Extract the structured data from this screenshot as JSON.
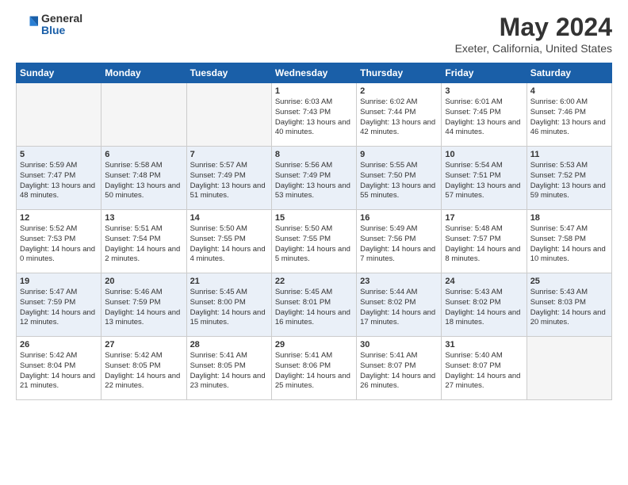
{
  "header": {
    "logo": {
      "general": "General",
      "blue": "Blue"
    },
    "title": "May 2024",
    "location": "Exeter, California, United States"
  },
  "weekdays": [
    "Sunday",
    "Monday",
    "Tuesday",
    "Wednesday",
    "Thursday",
    "Friday",
    "Saturday"
  ],
  "weeks": [
    [
      {
        "day": "",
        "sunrise": "",
        "sunset": "",
        "daylight": ""
      },
      {
        "day": "",
        "sunrise": "",
        "sunset": "",
        "daylight": ""
      },
      {
        "day": "",
        "sunrise": "",
        "sunset": "",
        "daylight": ""
      },
      {
        "day": "1",
        "sunrise": "Sunrise: 6:03 AM",
        "sunset": "Sunset: 7:43 PM",
        "daylight": "Daylight: 13 hours and 40 minutes."
      },
      {
        "day": "2",
        "sunrise": "Sunrise: 6:02 AM",
        "sunset": "Sunset: 7:44 PM",
        "daylight": "Daylight: 13 hours and 42 minutes."
      },
      {
        "day": "3",
        "sunrise": "Sunrise: 6:01 AM",
        "sunset": "Sunset: 7:45 PM",
        "daylight": "Daylight: 13 hours and 44 minutes."
      },
      {
        "day": "4",
        "sunrise": "Sunrise: 6:00 AM",
        "sunset": "Sunset: 7:46 PM",
        "daylight": "Daylight: 13 hours and 46 minutes."
      }
    ],
    [
      {
        "day": "5",
        "sunrise": "Sunrise: 5:59 AM",
        "sunset": "Sunset: 7:47 PM",
        "daylight": "Daylight: 13 hours and 48 minutes."
      },
      {
        "day": "6",
        "sunrise": "Sunrise: 5:58 AM",
        "sunset": "Sunset: 7:48 PM",
        "daylight": "Daylight: 13 hours and 50 minutes."
      },
      {
        "day": "7",
        "sunrise": "Sunrise: 5:57 AM",
        "sunset": "Sunset: 7:49 PM",
        "daylight": "Daylight: 13 hours and 51 minutes."
      },
      {
        "day": "8",
        "sunrise": "Sunrise: 5:56 AM",
        "sunset": "Sunset: 7:49 PM",
        "daylight": "Daylight: 13 hours and 53 minutes."
      },
      {
        "day": "9",
        "sunrise": "Sunrise: 5:55 AM",
        "sunset": "Sunset: 7:50 PM",
        "daylight": "Daylight: 13 hours and 55 minutes."
      },
      {
        "day": "10",
        "sunrise": "Sunrise: 5:54 AM",
        "sunset": "Sunset: 7:51 PM",
        "daylight": "Daylight: 13 hours and 57 minutes."
      },
      {
        "day": "11",
        "sunrise": "Sunrise: 5:53 AM",
        "sunset": "Sunset: 7:52 PM",
        "daylight": "Daylight: 13 hours and 59 minutes."
      }
    ],
    [
      {
        "day": "12",
        "sunrise": "Sunrise: 5:52 AM",
        "sunset": "Sunset: 7:53 PM",
        "daylight": "Daylight: 14 hours and 0 minutes."
      },
      {
        "day": "13",
        "sunrise": "Sunrise: 5:51 AM",
        "sunset": "Sunset: 7:54 PM",
        "daylight": "Daylight: 14 hours and 2 minutes."
      },
      {
        "day": "14",
        "sunrise": "Sunrise: 5:50 AM",
        "sunset": "Sunset: 7:55 PM",
        "daylight": "Daylight: 14 hours and 4 minutes."
      },
      {
        "day": "15",
        "sunrise": "Sunrise: 5:50 AM",
        "sunset": "Sunset: 7:55 PM",
        "daylight": "Daylight: 14 hours and 5 minutes."
      },
      {
        "day": "16",
        "sunrise": "Sunrise: 5:49 AM",
        "sunset": "Sunset: 7:56 PM",
        "daylight": "Daylight: 14 hours and 7 minutes."
      },
      {
        "day": "17",
        "sunrise": "Sunrise: 5:48 AM",
        "sunset": "Sunset: 7:57 PM",
        "daylight": "Daylight: 14 hours and 8 minutes."
      },
      {
        "day": "18",
        "sunrise": "Sunrise: 5:47 AM",
        "sunset": "Sunset: 7:58 PM",
        "daylight": "Daylight: 14 hours and 10 minutes."
      }
    ],
    [
      {
        "day": "19",
        "sunrise": "Sunrise: 5:47 AM",
        "sunset": "Sunset: 7:59 PM",
        "daylight": "Daylight: 14 hours and 12 minutes."
      },
      {
        "day": "20",
        "sunrise": "Sunrise: 5:46 AM",
        "sunset": "Sunset: 7:59 PM",
        "daylight": "Daylight: 14 hours and 13 minutes."
      },
      {
        "day": "21",
        "sunrise": "Sunrise: 5:45 AM",
        "sunset": "Sunset: 8:00 PM",
        "daylight": "Daylight: 14 hours and 15 minutes."
      },
      {
        "day": "22",
        "sunrise": "Sunrise: 5:45 AM",
        "sunset": "Sunset: 8:01 PM",
        "daylight": "Daylight: 14 hours and 16 minutes."
      },
      {
        "day": "23",
        "sunrise": "Sunrise: 5:44 AM",
        "sunset": "Sunset: 8:02 PM",
        "daylight": "Daylight: 14 hours and 17 minutes."
      },
      {
        "day": "24",
        "sunrise": "Sunrise: 5:43 AM",
        "sunset": "Sunset: 8:02 PM",
        "daylight": "Daylight: 14 hours and 18 minutes."
      },
      {
        "day": "25",
        "sunrise": "Sunrise: 5:43 AM",
        "sunset": "Sunset: 8:03 PM",
        "daylight": "Daylight: 14 hours and 20 minutes."
      }
    ],
    [
      {
        "day": "26",
        "sunrise": "Sunrise: 5:42 AM",
        "sunset": "Sunset: 8:04 PM",
        "daylight": "Daylight: 14 hours and 21 minutes."
      },
      {
        "day": "27",
        "sunrise": "Sunrise: 5:42 AM",
        "sunset": "Sunset: 8:05 PM",
        "daylight": "Daylight: 14 hours and 22 minutes."
      },
      {
        "day": "28",
        "sunrise": "Sunrise: 5:41 AM",
        "sunset": "Sunset: 8:05 PM",
        "daylight": "Daylight: 14 hours and 23 minutes."
      },
      {
        "day": "29",
        "sunrise": "Sunrise: 5:41 AM",
        "sunset": "Sunset: 8:06 PM",
        "daylight": "Daylight: 14 hours and 25 minutes."
      },
      {
        "day": "30",
        "sunrise": "Sunrise: 5:41 AM",
        "sunset": "Sunset: 8:07 PM",
        "daylight": "Daylight: 14 hours and 26 minutes."
      },
      {
        "day": "31",
        "sunrise": "Sunrise: 5:40 AM",
        "sunset": "Sunset: 8:07 PM",
        "daylight": "Daylight: 14 hours and 27 minutes."
      },
      {
        "day": "",
        "sunrise": "",
        "sunset": "",
        "daylight": ""
      }
    ]
  ]
}
